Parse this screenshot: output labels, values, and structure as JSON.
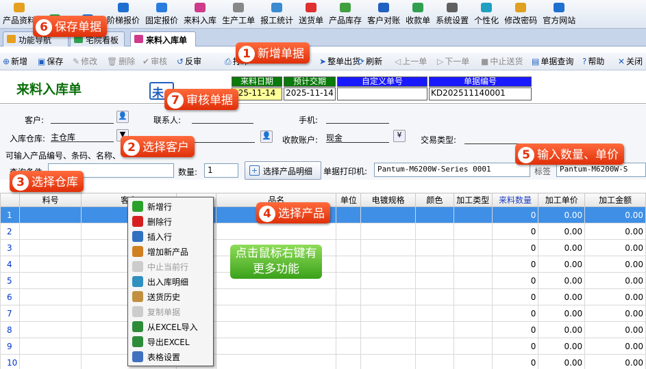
{
  "menu": [
    "产品资料",
    "",
    "",
    "阶梯报价",
    "固定报价",
    "来料入库",
    "生产工单",
    "报工统计",
    "送货单",
    "产品库存",
    "客户对账",
    "收款单",
    "系统设置",
    "个性化",
    "修改密码",
    "官方网站"
  ],
  "menu_icon_colors": [
    "#e6a020",
    "#2c9c3c",
    "#1f6fd0",
    "#1f6fd0",
    "#2a7be0",
    "#d03a8a",
    "#888888",
    "#3a8bd0",
    "#e03030",
    "#40a040",
    "#2060c0",
    "#30a050",
    "#606060",
    "#20a0c0",
    "#e0a020",
    "#2070d0"
  ],
  "tabs": {
    "first": "功能导航",
    "second": "宅院看板",
    "active": "来料入库单"
  },
  "toolbar": [
    {
      "label": "新增",
      "icon": "plus-circle-icon",
      "disabled": false
    },
    {
      "label": "保存",
      "icon": "save-icon",
      "disabled": false
    },
    {
      "label": "修改",
      "icon": "pencil-icon",
      "disabled": true
    },
    {
      "label": "删除",
      "icon": "trash-icon",
      "disabled": true
    },
    {
      "label": "审核",
      "icon": "approve-icon",
      "disabled": true
    },
    {
      "label": "反审",
      "icon": "unapprove-icon",
      "disabled": false
    },
    {
      "label": "打印",
      "icon": "print-icon",
      "disabled": false
    },
    {
      "label": "整单出货",
      "icon": "ship-icon",
      "disabled": false
    },
    {
      "label": "刷新",
      "icon": "refresh-icon",
      "disabled": false
    },
    {
      "label": "上一单",
      "icon": "prev-icon",
      "disabled": true
    },
    {
      "label": "下一单",
      "icon": "next-icon",
      "disabled": true
    },
    {
      "label": "中止送货",
      "icon": "stop-icon",
      "disabled": true
    },
    {
      "label": "单据查询",
      "icon": "search-doc-icon",
      "disabled": false
    },
    {
      "label": "帮助",
      "icon": "help-icon",
      "disabled": false
    },
    {
      "label": "关闭",
      "icon": "close-icon",
      "disabled": false
    }
  ],
  "header": {
    "title": "来料入库单",
    "stamp": "未",
    "labels": {
      "arrival_date": "来料日期",
      "delivery_date": "预计交期",
      "custom_no": "自定义单号",
      "doc_no": "单据编号"
    },
    "values": {
      "arrival_date": "25-11-14",
      "delivery_date": "2025-11-14",
      "custom_no": "",
      "doc_no": "KD202511140001"
    }
  },
  "form": {
    "customer_label": "客户:",
    "contact_label": "联系人:",
    "phone_label": "手机:",
    "warehouse_label": "入库仓库:",
    "warehouse_value": "主仓库",
    "account_label": "收款账户:",
    "account_value": "现金",
    "trade_type_label": "交易类型:",
    "hint": "可输入产品编号、条码、名称、",
    "query_label": "查询条件",
    "qty_label": "数量:",
    "qty_value": "1",
    "select_product_btn": "选择产品明细",
    "printer_label": "单据打印机:",
    "printer_value": "Pantum-M6200W-Series 0001",
    "label_printer": "标签",
    "label_printer_value": "Pantum-M6200W-S"
  },
  "grid": {
    "columns": [
      "",
      "料号",
      "客户",
      "",
      "品名",
      "单位",
      "电镀规格",
      "颜色",
      "加工类型",
      "来料数量",
      "加工单价",
      "加工金额"
    ],
    "rows": [
      {
        "n": "1",
        "qty": "0",
        "price": "0.00",
        "amount": "0.00"
      },
      {
        "n": "2",
        "qty": "0",
        "price": "0.00",
        "amount": "0.00"
      },
      {
        "n": "3",
        "qty": "0",
        "price": "0.00",
        "amount": "0.00"
      },
      {
        "n": "4",
        "qty": "0",
        "price": "0.00",
        "amount": "0.00"
      },
      {
        "n": "5",
        "qty": "0",
        "price": "0.00",
        "amount": "0.00"
      },
      {
        "n": "6",
        "qty": "0",
        "price": "0.00",
        "amount": "0.00"
      },
      {
        "n": "7",
        "qty": "0",
        "price": "0.00",
        "amount": "0.00"
      },
      {
        "n": "8",
        "qty": "0",
        "price": "0.00",
        "amount": "0.00"
      },
      {
        "n": "9",
        "qty": "0",
        "price": "0.00",
        "amount": "0.00"
      },
      {
        "n": "10",
        "qty": "0",
        "price": "0.00",
        "amount": "0.00"
      }
    ]
  },
  "context_menu": [
    {
      "label": "新增行",
      "icon": "add-row-icon",
      "color": "#2ca02c",
      "disabled": false
    },
    {
      "label": "删除行",
      "icon": "delete-row-icon",
      "color": "#d62020",
      "disabled": false
    },
    {
      "label": "插入行",
      "icon": "insert-row-icon",
      "color": "#3070c0",
      "disabled": false
    },
    {
      "label": "增加新产品",
      "icon": "new-product-icon",
      "color": "#d08020",
      "disabled": false
    },
    {
      "label": "中止当前行",
      "icon": "stop-row-icon",
      "color": "#cccccc",
      "disabled": true
    },
    {
      "label": "出入库明细",
      "icon": "stock-detail-icon",
      "color": "#3090c0",
      "disabled": false
    },
    {
      "label": "送货历史",
      "icon": "delivery-history-icon",
      "color": "#c09040",
      "disabled": false
    },
    {
      "label": "复制单据",
      "icon": "copy-doc-icon",
      "color": "#cccccc",
      "disabled": true
    },
    {
      "label": "从EXCEL导入",
      "icon": "excel-import-icon",
      "color": "#2e8b3a",
      "disabled": false
    },
    {
      "label": "导出EXCEL",
      "icon": "excel-export-icon",
      "color": "#2e8b3a",
      "disabled": false
    },
    {
      "label": "表格设置",
      "icon": "table-settings-icon",
      "color": "#4070c0",
      "disabled": false
    }
  ],
  "callouts": {
    "c1": {
      "num": "1",
      "text": "新增单据"
    },
    "c2": {
      "num": "2",
      "text": "选择客户"
    },
    "c3": {
      "num": "3",
      "text": "选择仓库"
    },
    "c4": {
      "num": "4",
      "text": "选择产品"
    },
    "c5": {
      "num": "5",
      "text": "输入数量、单价"
    },
    "c6": {
      "num": "6",
      "text": "保存单据"
    },
    "c7": {
      "num": "7",
      "text": "审核单据"
    },
    "tip": "点击鼠标右键有更多功能"
  },
  "colors": {
    "accent": "#e0300a",
    "selected_row": "#3f8fe6",
    "title_green": "#0a6e0a",
    "header_blue": "#1a1aff"
  }
}
